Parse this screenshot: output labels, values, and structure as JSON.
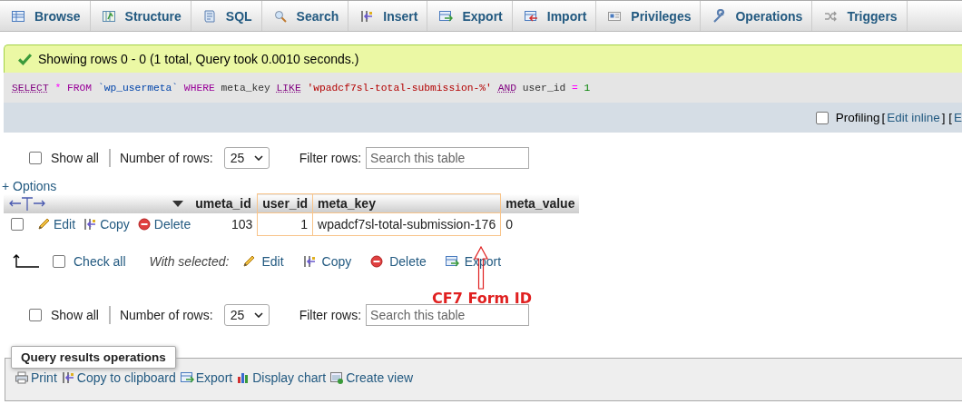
{
  "tabs": [
    {
      "label": "Browse",
      "kind": "browse",
      "selected": false
    },
    {
      "label": "Structure",
      "kind": "structure",
      "selected": false
    },
    {
      "label": "SQL",
      "kind": "sql",
      "selected": false
    },
    {
      "label": "Search",
      "kind": "search",
      "selected": false
    },
    {
      "label": "Insert",
      "kind": "insert",
      "selected": false
    },
    {
      "label": "Export",
      "kind": "export",
      "selected": false
    },
    {
      "label": "Import",
      "kind": "import",
      "selected": false
    },
    {
      "label": "Privileges",
      "kind": "privileges",
      "selected": false
    },
    {
      "label": "Operations",
      "kind": "operations",
      "selected": false
    },
    {
      "label": "Triggers",
      "kind": "triggers",
      "selected": false
    }
  ],
  "message": "Showing rows 0 - 0 (1 total, Query took 0.0010 seconds.)",
  "sql": [
    {
      "text": "SELECT",
      "kind": "keyword"
    },
    {
      "text": "*",
      "kind": "operator"
    },
    {
      "text": "FROM",
      "kind": "keyword2"
    },
    {
      "text": "`wp_usermeta`",
      "kind": "identifier"
    },
    {
      "text": "WHERE",
      "kind": "keyword2"
    },
    {
      "text": "meta_key",
      "kind": "plain"
    },
    {
      "text": "LIKE",
      "kind": "keyword"
    },
    {
      "text": "'wpadcf7sl-total-submission-%'",
      "kind": "string"
    },
    {
      "text": "AND",
      "kind": "keyword"
    },
    {
      "text": "user_id",
      "kind": "plain"
    },
    {
      "text": "=",
      "kind": "operator"
    },
    {
      "text": "1",
      "kind": "number"
    }
  ],
  "profiling": {
    "label": "Profiling",
    "checked": false,
    "items": [
      {
        "text": "[",
        "kind": "plain"
      },
      {
        "text": "Edit inline",
        "kind": "link"
      },
      {
        "text": "] [",
        "kind": "plain"
      },
      {
        "text": "E",
        "kind": "link"
      }
    ]
  },
  "navs": [
    {
      "show_all": "Show all",
      "checked": false,
      "rows_label": "Number of rows:",
      "rows_value": "25",
      "filter_label": "Filter rows:",
      "filter_placeholder": "Search this table"
    },
    {
      "show_all": "Show all",
      "checked": false,
      "rows_label": "Number of rows:",
      "rows_value": "25",
      "filter_label": "Filter rows:",
      "filter_placeholder": "Search this table"
    }
  ],
  "table": {
    "options": "+ Options",
    "columns": [
      {
        "label": "umeta_id",
        "kind": "number",
        "highlighted": false
      },
      {
        "label": "user_id",
        "kind": "number",
        "highlighted": true
      },
      {
        "label": "meta_key",
        "kind": "text",
        "highlighted": true
      },
      {
        "label": "meta_value",
        "kind": "text",
        "highlighted": false
      }
    ],
    "rows": [
      {
        "checked": false,
        "actions": [
          {
            "label": "Edit",
            "kind": "edit"
          },
          {
            "label": "Copy",
            "kind": "copy"
          },
          {
            "label": "Delete",
            "kind": "delete"
          }
        ],
        "cells": [
          "103",
          "1",
          "wpadcf7sl-total-submission-176",
          "0"
        ]
      }
    ]
  },
  "bulk": {
    "check_all": "Check all",
    "checked": false,
    "with_selected": "With selected:",
    "actions": [
      {
        "label": "Edit",
        "kind": "edit"
      },
      {
        "label": "Copy",
        "kind": "copy"
      },
      {
        "label": "Delete",
        "kind": "delete"
      },
      {
        "label": "Export",
        "kind": "export"
      }
    ]
  },
  "annotation": "CF7 Form ID",
  "operations": {
    "legend": "Query results operations",
    "actions": [
      {
        "label": "Print",
        "kind": "print"
      },
      {
        "label": "Copy to clipboard",
        "kind": "copy"
      },
      {
        "label": "Export",
        "kind": "export"
      },
      {
        "label": "Display chart",
        "kind": "chart"
      },
      {
        "label": "Create view",
        "kind": "view"
      }
    ]
  }
}
